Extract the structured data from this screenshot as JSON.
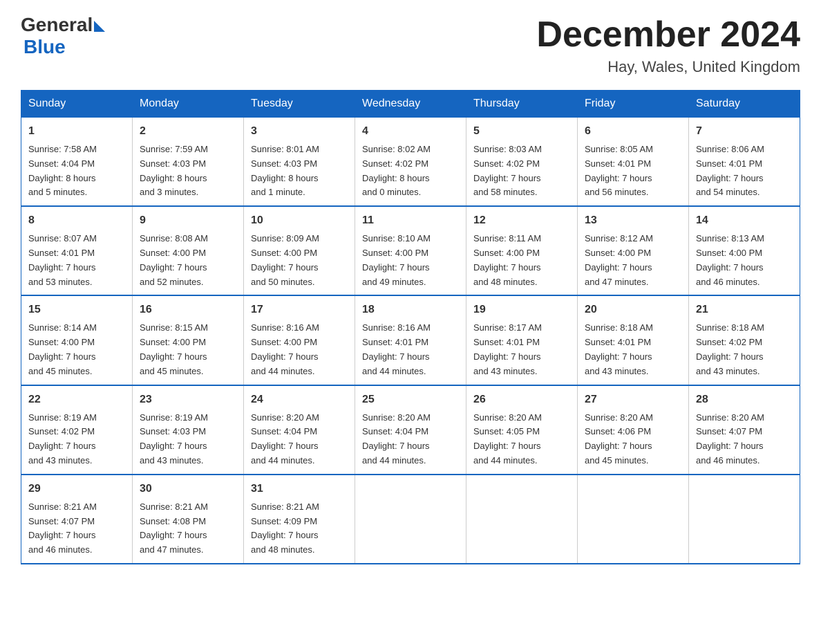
{
  "header": {
    "logo_general": "General",
    "logo_blue": "Blue",
    "title": "December 2024",
    "subtitle": "Hay, Wales, United Kingdom"
  },
  "columns": [
    "Sunday",
    "Monday",
    "Tuesday",
    "Wednesday",
    "Thursday",
    "Friday",
    "Saturday"
  ],
  "weeks": [
    [
      {
        "day": "1",
        "info": "Sunrise: 7:58 AM\nSunset: 4:04 PM\nDaylight: 8 hours\nand 5 minutes."
      },
      {
        "day": "2",
        "info": "Sunrise: 7:59 AM\nSunset: 4:03 PM\nDaylight: 8 hours\nand 3 minutes."
      },
      {
        "day": "3",
        "info": "Sunrise: 8:01 AM\nSunset: 4:03 PM\nDaylight: 8 hours\nand 1 minute."
      },
      {
        "day": "4",
        "info": "Sunrise: 8:02 AM\nSunset: 4:02 PM\nDaylight: 8 hours\nand 0 minutes."
      },
      {
        "day": "5",
        "info": "Sunrise: 8:03 AM\nSunset: 4:02 PM\nDaylight: 7 hours\nand 58 minutes."
      },
      {
        "day": "6",
        "info": "Sunrise: 8:05 AM\nSunset: 4:01 PM\nDaylight: 7 hours\nand 56 minutes."
      },
      {
        "day": "7",
        "info": "Sunrise: 8:06 AM\nSunset: 4:01 PM\nDaylight: 7 hours\nand 54 minutes."
      }
    ],
    [
      {
        "day": "8",
        "info": "Sunrise: 8:07 AM\nSunset: 4:01 PM\nDaylight: 7 hours\nand 53 minutes."
      },
      {
        "day": "9",
        "info": "Sunrise: 8:08 AM\nSunset: 4:00 PM\nDaylight: 7 hours\nand 52 minutes."
      },
      {
        "day": "10",
        "info": "Sunrise: 8:09 AM\nSunset: 4:00 PM\nDaylight: 7 hours\nand 50 minutes."
      },
      {
        "day": "11",
        "info": "Sunrise: 8:10 AM\nSunset: 4:00 PM\nDaylight: 7 hours\nand 49 minutes."
      },
      {
        "day": "12",
        "info": "Sunrise: 8:11 AM\nSunset: 4:00 PM\nDaylight: 7 hours\nand 48 minutes."
      },
      {
        "day": "13",
        "info": "Sunrise: 8:12 AM\nSunset: 4:00 PM\nDaylight: 7 hours\nand 47 minutes."
      },
      {
        "day": "14",
        "info": "Sunrise: 8:13 AM\nSunset: 4:00 PM\nDaylight: 7 hours\nand 46 minutes."
      }
    ],
    [
      {
        "day": "15",
        "info": "Sunrise: 8:14 AM\nSunset: 4:00 PM\nDaylight: 7 hours\nand 45 minutes."
      },
      {
        "day": "16",
        "info": "Sunrise: 8:15 AM\nSunset: 4:00 PM\nDaylight: 7 hours\nand 45 minutes."
      },
      {
        "day": "17",
        "info": "Sunrise: 8:16 AM\nSunset: 4:00 PM\nDaylight: 7 hours\nand 44 minutes."
      },
      {
        "day": "18",
        "info": "Sunrise: 8:16 AM\nSunset: 4:01 PM\nDaylight: 7 hours\nand 44 minutes."
      },
      {
        "day": "19",
        "info": "Sunrise: 8:17 AM\nSunset: 4:01 PM\nDaylight: 7 hours\nand 43 minutes."
      },
      {
        "day": "20",
        "info": "Sunrise: 8:18 AM\nSunset: 4:01 PM\nDaylight: 7 hours\nand 43 minutes."
      },
      {
        "day": "21",
        "info": "Sunrise: 8:18 AM\nSunset: 4:02 PM\nDaylight: 7 hours\nand 43 minutes."
      }
    ],
    [
      {
        "day": "22",
        "info": "Sunrise: 8:19 AM\nSunset: 4:02 PM\nDaylight: 7 hours\nand 43 minutes."
      },
      {
        "day": "23",
        "info": "Sunrise: 8:19 AM\nSunset: 4:03 PM\nDaylight: 7 hours\nand 43 minutes."
      },
      {
        "day": "24",
        "info": "Sunrise: 8:20 AM\nSunset: 4:04 PM\nDaylight: 7 hours\nand 44 minutes."
      },
      {
        "day": "25",
        "info": "Sunrise: 8:20 AM\nSunset: 4:04 PM\nDaylight: 7 hours\nand 44 minutes."
      },
      {
        "day": "26",
        "info": "Sunrise: 8:20 AM\nSunset: 4:05 PM\nDaylight: 7 hours\nand 44 minutes."
      },
      {
        "day": "27",
        "info": "Sunrise: 8:20 AM\nSunset: 4:06 PM\nDaylight: 7 hours\nand 45 minutes."
      },
      {
        "day": "28",
        "info": "Sunrise: 8:20 AM\nSunset: 4:07 PM\nDaylight: 7 hours\nand 46 minutes."
      }
    ],
    [
      {
        "day": "29",
        "info": "Sunrise: 8:21 AM\nSunset: 4:07 PM\nDaylight: 7 hours\nand 46 minutes."
      },
      {
        "day": "30",
        "info": "Sunrise: 8:21 AM\nSunset: 4:08 PM\nDaylight: 7 hours\nand 47 minutes."
      },
      {
        "day": "31",
        "info": "Sunrise: 8:21 AM\nSunset: 4:09 PM\nDaylight: 7 hours\nand 48 minutes."
      },
      {
        "day": "",
        "info": ""
      },
      {
        "day": "",
        "info": ""
      },
      {
        "day": "",
        "info": ""
      },
      {
        "day": "",
        "info": ""
      }
    ]
  ]
}
